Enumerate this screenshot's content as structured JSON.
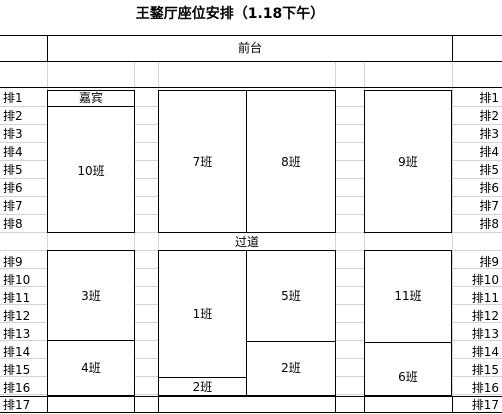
{
  "title": "王鍪厅座位安排（1.18下午）",
  "stage_label": "前台",
  "aisle_label": "过道",
  "rows_top": [
    "排1",
    "排2",
    "排3",
    "排4",
    "排5",
    "排6",
    "排7",
    "排8"
  ],
  "rows_bottom": [
    "排9",
    "排10",
    "排11",
    "排12",
    "排13",
    "排14",
    "排15",
    "排16",
    "排17"
  ],
  "blocks": {
    "guest": "嘉宾",
    "class10": "10班",
    "class7": "7班",
    "class8": "8班",
    "class9": "9班",
    "class3": "3班",
    "class1": "1班",
    "class5": "5班",
    "class11": "11班",
    "class4": "4班",
    "class2a": "2班",
    "class2b": "2班",
    "class6": "6班"
  }
}
